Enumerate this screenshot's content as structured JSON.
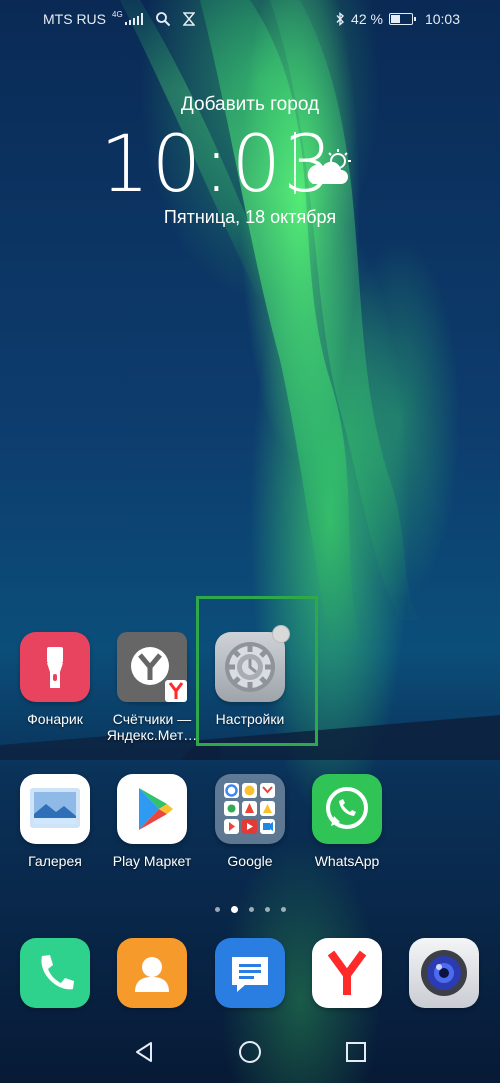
{
  "status_bar": {
    "carrier": "MTS RUS",
    "network": "4G",
    "battery": "42 %",
    "time": "10:03"
  },
  "clock_widget": {
    "city": "Добавить город",
    "time": "10:03",
    "date": "Пятница, 18 октября",
    "weather_icon": "partly-cloudy-icon"
  },
  "home_rows": [
    [
      {
        "name": "flashlight",
        "label": "Фонарик"
      },
      {
        "name": "yandex-counters",
        "label": "Счётчики — Яндекс.Мет…"
      },
      {
        "name": "settings",
        "label": "Настройки"
      }
    ],
    [
      {
        "name": "gallery",
        "label": "Галерея"
      },
      {
        "name": "play-market",
        "label": "Play Маркет"
      },
      {
        "name": "google-folder",
        "label": "Google"
      },
      {
        "name": "whatsapp",
        "label": "WhatsApp"
      }
    ]
  ],
  "page_indicator": {
    "count": 5,
    "active": 1
  },
  "dock": [
    "phone",
    "contacts",
    "messages",
    "yandex-browser",
    "camera"
  ],
  "colors": {
    "highlight": "#2fa84a",
    "flashlight": "#e8445f",
    "whatsapp": "#2fc455",
    "phone": "#2fd28c",
    "contacts": "#f59a2b",
    "messages": "#2a7de1",
    "yandex": "#ff2a2a"
  }
}
